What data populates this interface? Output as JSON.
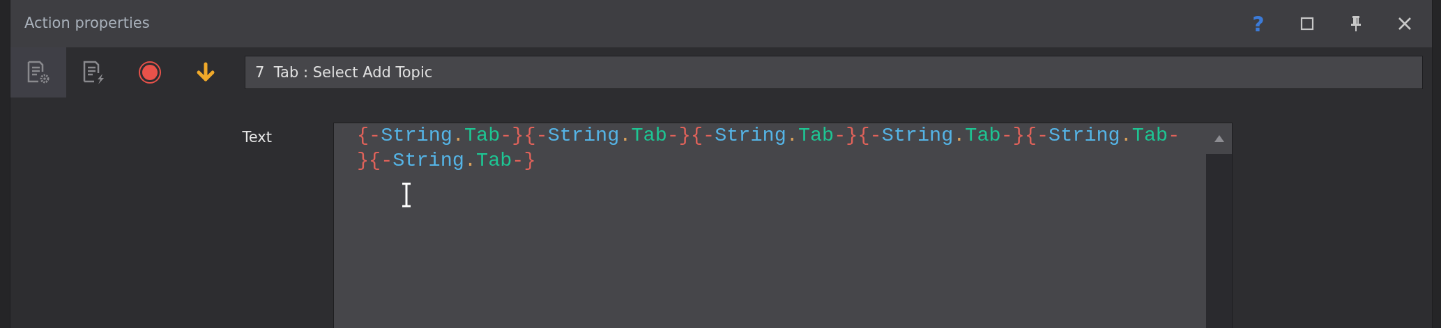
{
  "window": {
    "title": "Action properties",
    "buttons": [
      {
        "kind": "help",
        "label": "?"
      },
      {
        "kind": "maximize"
      },
      {
        "kind": "pin"
      },
      {
        "kind": "close"
      }
    ]
  },
  "toolbar": {
    "buttons": [
      {
        "kind": "properties",
        "selected": true
      },
      {
        "kind": "script",
        "selected": false
      },
      {
        "kind": "record",
        "selected": false
      },
      {
        "kind": "down",
        "selected": false
      }
    ],
    "action_field": {
      "value": "7  Tab : Select Add Topic"
    }
  },
  "properties": [
    {
      "label": "Text",
      "lines": [
        [
          {
            "text": "{-",
            "kind": "brace"
          },
          {
            "text": "String",
            "kind": "object"
          },
          {
            "text": ".",
            "kind": "dot"
          },
          {
            "text": "Tab",
            "kind": "member"
          },
          {
            "text": "-}{-",
            "kind": "brace"
          },
          {
            "text": "String",
            "kind": "object"
          },
          {
            "text": ".",
            "kind": "dot"
          },
          {
            "text": "Tab",
            "kind": "member"
          },
          {
            "text": "-}{-",
            "kind": "brace"
          },
          {
            "text": "String",
            "kind": "object"
          },
          {
            "text": ".",
            "kind": "dot"
          },
          {
            "text": "Tab",
            "kind": "member"
          },
          {
            "text": "-}{-",
            "kind": "brace"
          },
          {
            "text": "String",
            "kind": "object"
          },
          {
            "text": ".",
            "kind": "dot"
          },
          {
            "text": "Tab",
            "kind": "member"
          },
          {
            "text": "-}{-",
            "kind": "brace"
          },
          {
            "text": "String",
            "kind": "object"
          },
          {
            "text": ".",
            "kind": "dot"
          },
          {
            "text": "Tab",
            "kind": "member"
          },
          {
            "text": "-",
            "kind": "brace"
          }
        ],
        [
          {
            "text": "}{-",
            "kind": "brace"
          },
          {
            "text": "String",
            "kind": "object"
          },
          {
            "text": ".",
            "kind": "dot"
          },
          {
            "text": "Tab",
            "kind": "member"
          },
          {
            "text": "-}",
            "kind": "brace"
          }
        ]
      ]
    }
  ]
}
